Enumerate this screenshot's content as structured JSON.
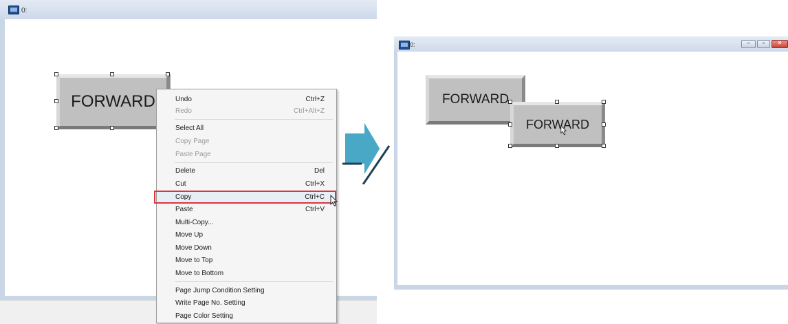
{
  "left_window": {
    "title": "0:"
  },
  "left_button": {
    "label": "FORWARD"
  },
  "context_menu": {
    "items": [
      {
        "label": "Undo",
        "shortcut": "Ctrl+Z",
        "disabled": false
      },
      {
        "label": "Redo",
        "shortcut": "Ctrl+Alt+Z",
        "disabled": true
      },
      {
        "label": "Select All",
        "shortcut": "",
        "disabled": false
      },
      {
        "label": "Copy Page",
        "shortcut": "",
        "disabled": true
      },
      {
        "label": "Paste Page",
        "shortcut": "",
        "disabled": true
      },
      {
        "label": "Delete",
        "shortcut": "Del",
        "disabled": false
      },
      {
        "label": "Cut",
        "shortcut": "Ctrl+X",
        "disabled": false
      },
      {
        "label": "Copy",
        "shortcut": "Ctrl+C",
        "disabled": false
      },
      {
        "label": "Paste",
        "shortcut": "Ctrl+V",
        "disabled": false
      },
      {
        "label": "Multi-Copy...",
        "shortcut": "",
        "disabled": false
      },
      {
        "label": "Move Up",
        "shortcut": "",
        "disabled": false
      },
      {
        "label": "Move Down",
        "shortcut": "",
        "disabled": false
      },
      {
        "label": "Move to Top",
        "shortcut": "",
        "disabled": false
      },
      {
        "label": "Move to Bottom",
        "shortcut": "",
        "disabled": false
      },
      {
        "label": "Page Jump Condition Setting",
        "shortcut": "",
        "disabled": false
      },
      {
        "label": "Write Page No. Setting",
        "shortcut": "",
        "disabled": false
      },
      {
        "label": "Page Color Setting",
        "shortcut": "",
        "disabled": false
      }
    ],
    "highlighted_item": "Copy",
    "highlight_color": "#d9363e"
  },
  "right_window": {
    "title": "0:",
    "controls": {
      "minimize": "–",
      "restore": "▫",
      "close": "×"
    }
  },
  "right_buttons": {
    "original_label": "FORWARD",
    "copied_label": "FORWARD"
  },
  "colors": {
    "arrow": "#4aa8c7",
    "button_face": "#c0c0c0",
    "window_frame": "#c9d6e6"
  }
}
